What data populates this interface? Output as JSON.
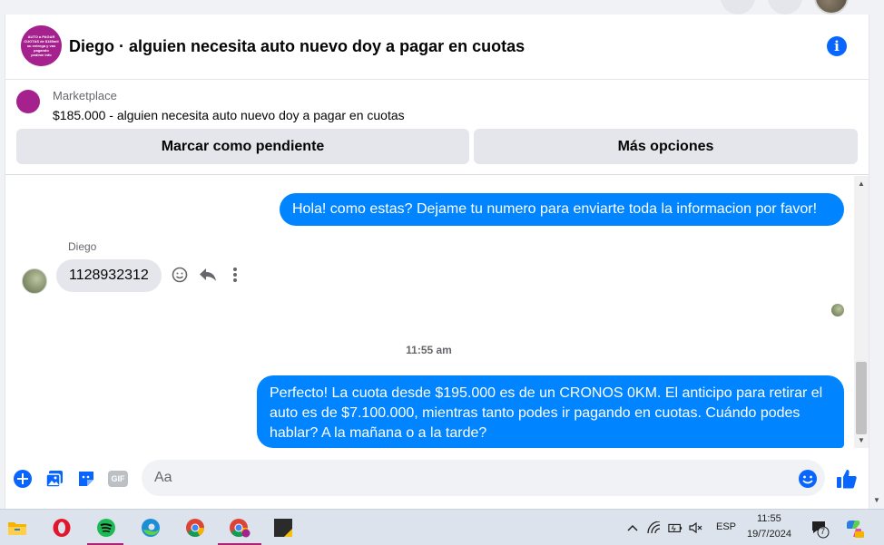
{
  "chat": {
    "title": "Diego · alguien necesita auto nuevo doy a pagar en cuotas",
    "avatar_text": [
      "AUTO a PAGAR",
      "CUOTAS de $185mil",
      "su entrega y vas",
      "pagando",
      "pedime info"
    ]
  },
  "marketplace": {
    "label": "Marketplace",
    "item": "$185.000 - alguien necesita auto nuevo doy a pagar en cuotas",
    "pending_button": "Marcar como pendiente",
    "more_button": "Más opciones"
  },
  "messages": {
    "outgoing_1": "Hola! como estas? Dejame tu numero para enviarte toda la informacion por favor!",
    "sender_name": "Diego",
    "incoming_1": "1128932312",
    "timestamp": "11:55 am",
    "outgoing_2": "Perfecto! La cuota desde $195.000 es de un CRONOS 0KM. El anticipo para retirar el auto es de $7.100.000, mientras tanto podes ir pagando en cuotas. Cuándo podes hablar? A la mañana o a la tarde?"
  },
  "composer": {
    "placeholder": "Aa",
    "gif_label": "GIF"
  },
  "taskbar": {
    "language": "ESP",
    "time": "11:55",
    "date": "19/7/2024",
    "notification_count": "7"
  },
  "colors": {
    "messenger_blue": "#0084ff",
    "accent_blue": "#0866ff"
  }
}
